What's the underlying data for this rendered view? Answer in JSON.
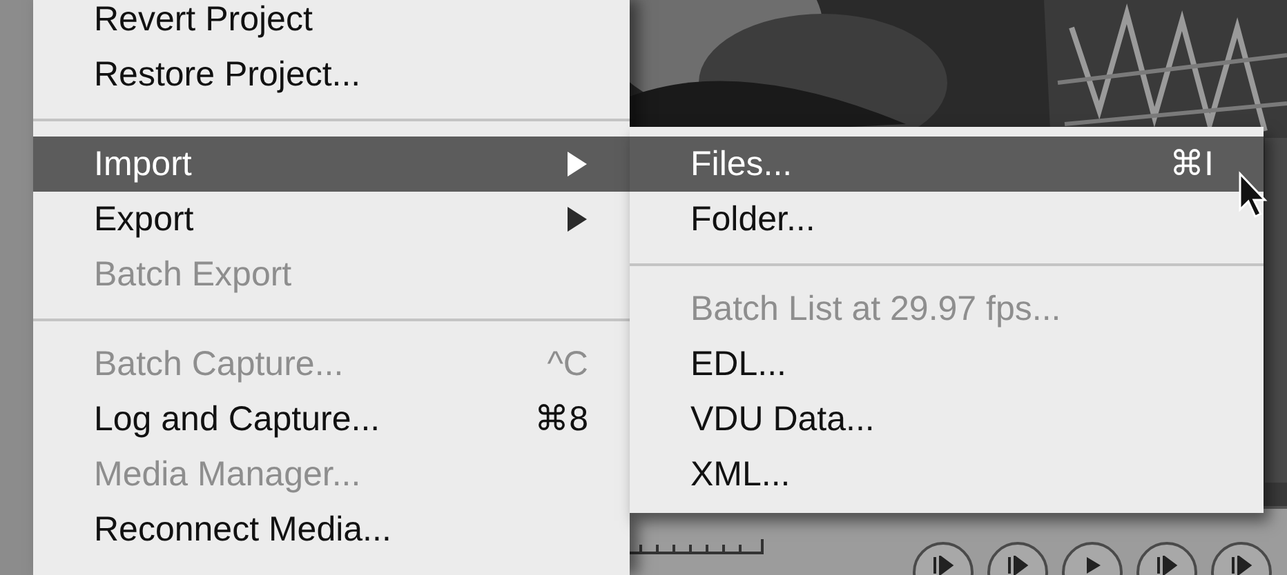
{
  "menu": {
    "items": [
      {
        "kind": "item",
        "label": "Revert Project",
        "disabled": false,
        "selected": false,
        "submenu": false
      },
      {
        "kind": "item",
        "label": "Restore Project...",
        "disabled": false,
        "selected": false,
        "submenu": false
      },
      {
        "kind": "separator"
      },
      {
        "kind": "item",
        "label": "Import",
        "disabled": false,
        "selected": true,
        "submenu": true
      },
      {
        "kind": "item",
        "label": "Export",
        "disabled": false,
        "selected": false,
        "submenu": true
      },
      {
        "kind": "item",
        "label": "Batch Export",
        "disabled": true,
        "selected": false,
        "submenu": false
      },
      {
        "kind": "separator"
      },
      {
        "kind": "item",
        "label": "Batch Capture...",
        "shortcut": "^C",
        "disabled": true,
        "selected": false,
        "submenu": false
      },
      {
        "kind": "item",
        "label": "Log and Capture...",
        "shortcut": "⌘8",
        "disabled": false,
        "selected": false,
        "submenu": false
      },
      {
        "kind": "item",
        "label": "Media Manager...",
        "disabled": true,
        "selected": false,
        "submenu": false
      },
      {
        "kind": "item",
        "label": "Reconnect Media...",
        "disabled": false,
        "selected": false,
        "submenu": false
      }
    ]
  },
  "submenu": {
    "items": [
      {
        "kind": "item",
        "label": "Files...",
        "shortcut": "⌘I",
        "disabled": false,
        "selected": true
      },
      {
        "kind": "item",
        "label": "Folder...",
        "disabled": false,
        "selected": false
      },
      {
        "kind": "separator"
      },
      {
        "kind": "item",
        "label": "Batch List at 29.97 fps...",
        "disabled": true,
        "selected": false
      },
      {
        "kind": "item",
        "label": "EDL...",
        "disabled": false,
        "selected": false
      },
      {
        "kind": "item",
        "label": "VDU Data...",
        "disabled": false,
        "selected": false
      },
      {
        "kind": "item",
        "label": "XML...",
        "disabled": false,
        "selected": false
      }
    ]
  }
}
